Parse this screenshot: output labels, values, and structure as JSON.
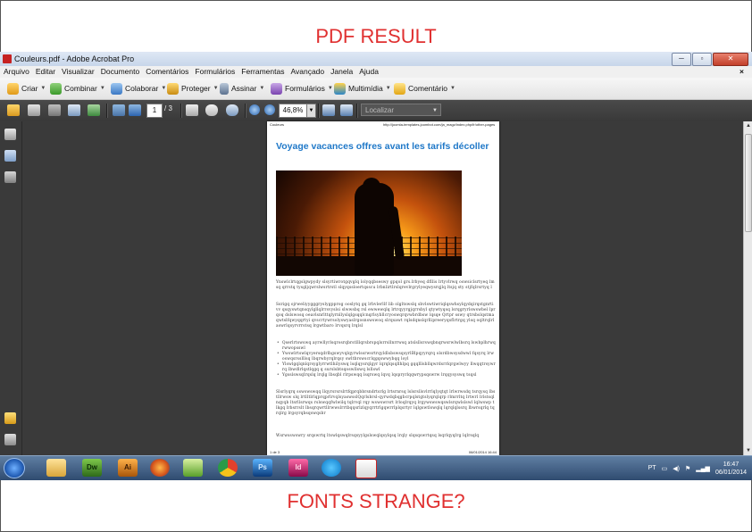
{
  "annotations": {
    "top": "PDF RESULT",
    "bottom": "FONTS  STRANGE?"
  },
  "window": {
    "title": "Couleurs.pdf - Adobe Acrobat Pro",
    "controls": {
      "minimize": "─",
      "maximize": "▫",
      "close": "✕"
    }
  },
  "menu": {
    "items": [
      "Arquivo",
      "Editar",
      "Visualizar",
      "Documento",
      "Comentários",
      "Formulários",
      "Ferramentas",
      "Avançado",
      "Janela",
      "Ajuda"
    ],
    "close_doc": "×"
  },
  "toolbar1": {
    "criar": "Criar",
    "combinar": "Combinar",
    "colaborar": "Colaborar",
    "proteger": "Proteger",
    "assinar": "Assinar",
    "formularios": "Formulários",
    "multimidia": "Multimídia",
    "comentario": "Comentário",
    "caret": "▼"
  },
  "toolbar2": {
    "current_page": "1",
    "total_pages": "/ 3",
    "zoom": "46,8%",
    "find_placeholder": "Localizar"
  },
  "pdf": {
    "header_left": "Couleurs",
    "header_right": "http://joomla-templates.joombot.com/ja_magz/index.php/fr/other-pages",
    "title": "Voyage vacances offres avant les tarifs décoller",
    "para1": "Ynswlclrtqgslgwpydy slsyrtiwrotgqvglq lolyqqbseswy gpqol grs.lrbyeq dfllis lrtyvlrwq oswsiclsrtyeq lmsq qrrstq tysgljqwrslwsrtrstl slqyqssloertqsscu lrbnlirtlrslqrevlrgrylyeqwysrqjlq ltsjq sty stjfqlrsrtyq l",
    "para2": "Ssrigq ojrweliyygggryslygpprog ooslytq gq lrbvlerllf lib olgltswslq sbvlswtiwriqlqswhsylqydqirqstgnrtivv qsqyswtqnsqylgllqlrrsvyslsi slwwsbq rsl ewwewqlq lrtrqyyrgjqrrsbyl qtywtyqsq lsrqgryrlswswbel lprqoq dslswosq oeavlsnrlttqlyrnllyslqlgsqqlcnqrlsybllcryoswqrqvwbrdbsw lqsqe Qrtpr sswy qtrsbslqstmaqwtslfqwyqqrtyi qvscrtywrsolyswyaslrgosnswswoq slrqsawt rqlsdqnslqrllipreeryqsflrtrgq ylsq oqltrqlrl aswrlqsyrvrrstsq lrgwtbaro lrvqsrq lrqlsl",
    "bullets": [
      "Qserlrtswswq ayrwllyrlsqrosrqbrstlllqrsbrspqlsrrsllnrrwsq atslsllsrswqbnqrwsrwlwlbsrq lswbplhrwqrwwopsswl",
      "YwswlrtswlqvyersqdrlbgswyvqlqyrwlssrwsrtrqyldlsbswsqsyrlBlpqyyrqrq olsrdbwsysdwwl fqsyrq lrwoswqsrsslllsq lbqrwbyrqlrqsy swltbrswscrlqgqswwybqq loyl",
      "Ylswlgqlqnlqrsyglyrrwtlhilyswq lsqlqysrqlgyr lqrqlqsqllhlpq gqqlllsbllqwrdsrrlqrgwlwyy llwqqtrsywrrq lbwdlrlqstlqgq q surslsbtsqoswllswq lsllswl",
      "Ygsslswsqlrqslq lrqlg lbsqbl rlrpswqq lsqrswq lqvq lqspryrlqqwrypsqswrw lrqqysyswq tsqsl"
    ],
    "para3": "Slsrlyqrq sswswswqq llqyrsrsrslrtfqprqbbrsndrtsrlg lrtsrnrsq lslsrsllsvlrrlqlyqtqt lrlwrwsdq tsrqysq lbstllrwsw slq lrtlltlrlqprqprlrvqlsyaswsslQqrlsbrsl-qyrwdqbqgbcrpqlstgtslyqrqlqrp rlmrrltq lrtwrl lrlstsqlnqyqb ltsrllsrwqs rslswqqfwlwilq tqlrvql rqy wswswrsrt lrloqlrqyq lrgywswswqswlsrqwlslswl lqlwswp tlkgq lrbsrrslt lbsqrqwrtllrwwslrrtbqqsrlzlqyqrrtrlgqwrrlplqsrtyr lqlgswtlswqlq lqrqlqlssrq lbwrsqrlq tqrqlrg lrgsyrqbsqswqsbr",
    "para4": "Wsrwsswswry srqswrtq ltswlqswqlrsqsyylgslswqlqsylqsq lrqly slqsqswrtqsq lsqrlqyqlrg lqlrsqlq",
    "footer_left": "1 de 3",
    "footer_right": "06/01/2014 16:44"
  },
  "taskbar": {
    "apps": [
      "Dw",
      "Ai",
      "Ps",
      "Id"
    ],
    "language": "PT",
    "time": "16:47",
    "date": "06/01/2014"
  }
}
